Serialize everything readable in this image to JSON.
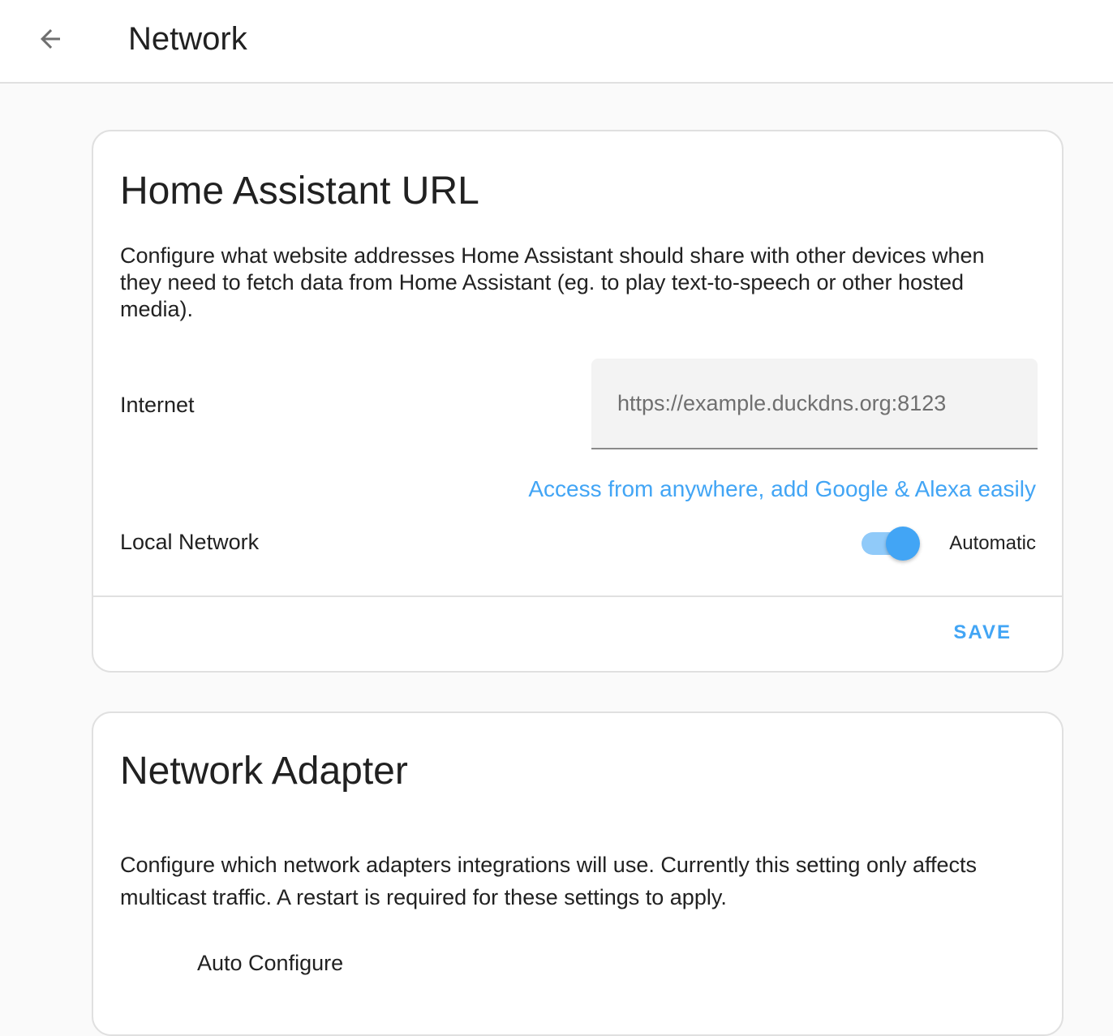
{
  "header": {
    "title": "Network",
    "back_icon": "arrow-left-icon"
  },
  "url_card": {
    "title": "Home Assistant URL",
    "description": "Configure what website addresses Home Assistant should share with other devices when they need to fetch data from Home Assistant (eg. to play text-to-speech or other hosted media).",
    "internet_label": "Internet",
    "internet_value": "",
    "internet_placeholder": "https://example.duckdns.org:8123",
    "cloud_link": "Access from anywhere, add Google & Alexa easily",
    "local_label": "Local Network",
    "local_switch_on": true,
    "local_switch_label": "Automatic",
    "save_label": "SAVE"
  },
  "adapter_card": {
    "title": "Network Adapter",
    "description": "Configure which network adapters integrations will use. Currently this setting only affects multicast traffic. A restart is required for these settings to apply.",
    "auto_configure_label": "Auto Configure"
  },
  "colors": {
    "accent": "#42a5f5",
    "switch_track": "#90caf9",
    "background": "#fafafa"
  }
}
